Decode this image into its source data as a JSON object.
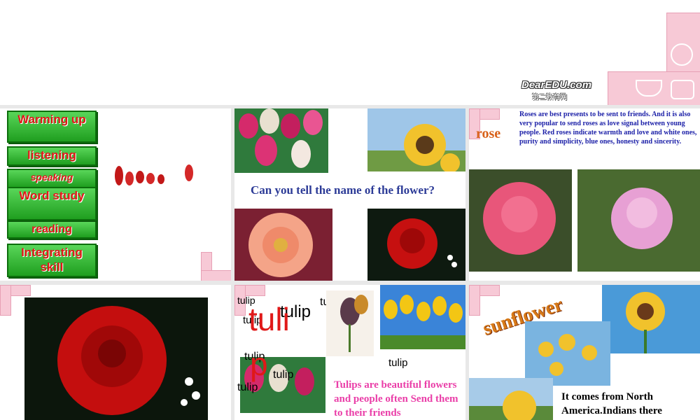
{
  "header": {
    "brand": "DearEDU.com",
    "brand_sub": "第二教育网"
  },
  "slide1": {
    "menu": [
      {
        "label": "Warming up"
      },
      {
        "label": "listening"
      },
      {
        "label": "speaking"
      },
      {
        "label": "Word study"
      },
      {
        "label": "reading"
      },
      {
        "label": "Integrating skill"
      }
    ]
  },
  "slide2": {
    "question": "Can you tell the name of the flower?"
  },
  "slide3": {
    "title": "rose",
    "text": "Roses are best presents to be sent to friends. And it is also very popular to send roses as love signal between young people. Red roses indicate warmth and love and white ones, purity and simplicity, blue ones, honesty and sincerity."
  },
  "slide5": {
    "labels": [
      "tulip",
      "tulip",
      "tulip",
      "tulip",
      "tulip",
      "tulip",
      "tulip"
    ],
    "big_text_1": "tuli",
    "big_text_2": "p",
    "caption": "tulip",
    "text": "Tulips are beautiful flowers and people often Send them to their friends"
  },
  "slide6": {
    "title": "sunflower",
    "text": "It comes from North America.Indians there"
  },
  "colors": {
    "accent_green": "#2eb82e",
    "menu_text_red": "#e01818",
    "question_blue": "#2c3b97",
    "rose_text_blue": "#1c20a8",
    "tulip_pink": "#ea3ea8",
    "corner_pink": "#f7c9d6"
  }
}
